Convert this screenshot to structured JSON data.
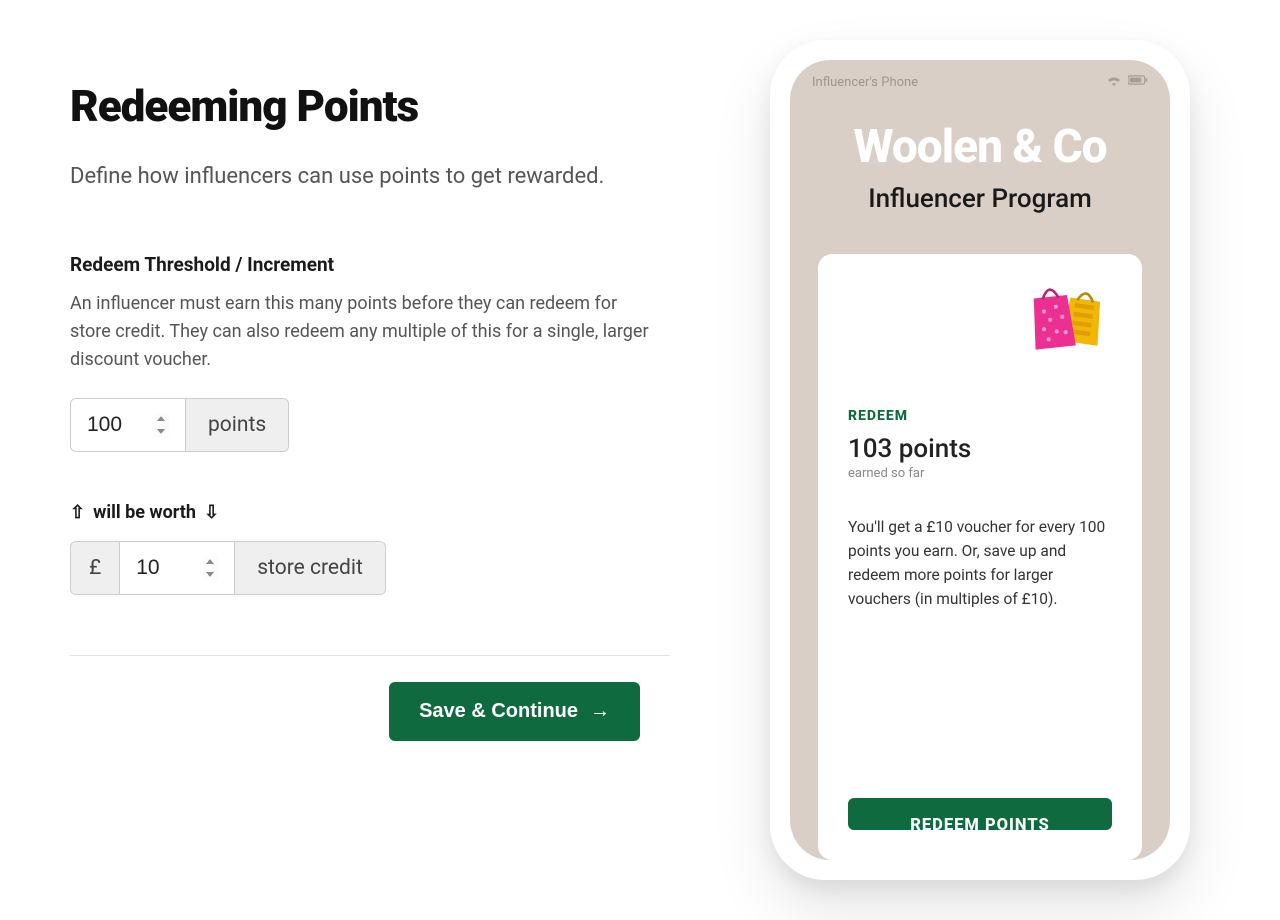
{
  "page": {
    "title": "Redeeming Points",
    "subtitle": "Define how influencers can use points to get rewarded."
  },
  "threshold": {
    "label": "Redeem Threshold / Increment",
    "desc": "An influencer must earn this many points before they can redeem for store credit. They can also redeem any multiple of this for a single, larger discount voucher.",
    "value": "100",
    "suffix": "points"
  },
  "worth": {
    "label": "will be worth",
    "currency": "£",
    "value": "10",
    "suffix": "store credit"
  },
  "actions": {
    "save": "Save & Continue"
  },
  "preview": {
    "device_label": "Influencer's Phone",
    "brand": "Woolen & Co",
    "program": "Influencer Program",
    "redeem_heading": "REDEEM",
    "points_line": "103 points",
    "earned": "earned so far",
    "explain": "You'll get a £10 voucher for every 100 points you earn. Or, save up and redeem more points for larger vouchers (in multiples of £10).",
    "button": "REDEEM POINTS"
  }
}
